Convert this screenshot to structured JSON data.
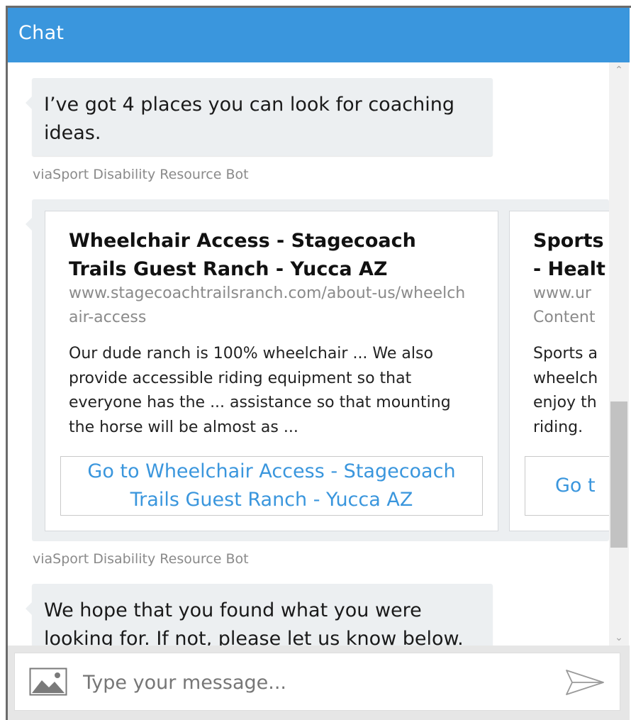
{
  "header": {
    "title": "Chat"
  },
  "messages": [
    {
      "text": "I’ve got 4 places you can look for coaching ideas.",
      "from": "viaSport Disability Resource Bot"
    },
    {
      "from": "viaSport Disability Resource Bot",
      "cards": [
        {
          "title": "Wheelchair Access - Stagecoach Trails Guest Ranch - Yucca AZ",
          "url": "www.stagecoachtrailsranch.com/about-us/wheelchair-access",
          "description": "Our dude ranch is 100% wheelchair ... We also provide accessible riding equipment so that everyone has the ... assistance so that mounting the horse will be almost as ...",
          "button": "Go to Wheelchair Access - Stagecoach Trails Guest Ranch - Yucca AZ"
        },
        {
          "title": "Sports",
          "title_line2": "- Healt",
          "url": "www.ur",
          "url_line2": "Content",
          "desc_lines": [
            "Sports a",
            "wheelch",
            "enjoy th",
            "riding."
          ],
          "button": "Go t"
        }
      ]
    },
    {
      "text": "We hope that you found what you were looking for. If not, please let us know below."
    }
  ],
  "composer": {
    "placeholder": "Type your message..."
  },
  "colors": {
    "accent": "#3a96dd",
    "bubble": "#eceff1",
    "muted_text": "#8a8a8a"
  },
  "icons": {
    "upload": "image-upload-icon",
    "send": "send-icon"
  }
}
